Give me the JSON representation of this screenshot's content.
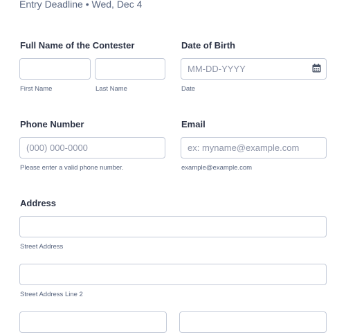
{
  "header": {
    "deadline": "Entry Deadline • Wed, Dec 4"
  },
  "full_name": {
    "label": "Full Name of the Contester",
    "first_sub": "First Name",
    "last_sub": "Last Name",
    "first_value": "",
    "last_value": ""
  },
  "dob": {
    "label": "Date of Birth",
    "placeholder": "MM-DD-YYYY",
    "sub": "Date",
    "icon": "calendar-icon"
  },
  "phone": {
    "label": "Phone Number",
    "placeholder": "(000) 000-0000",
    "sub": "Please enter a valid phone number."
  },
  "email": {
    "label": "Email",
    "placeholder": "ex: myname@example.com",
    "sub": "example@example.com"
  },
  "address": {
    "label": "Address",
    "street_sub": "Street Address",
    "street2_sub": "Street Address Line 2"
  },
  "colors": {
    "text": "#2c3345",
    "muted": "#57647e",
    "border": "#c3cad8"
  }
}
